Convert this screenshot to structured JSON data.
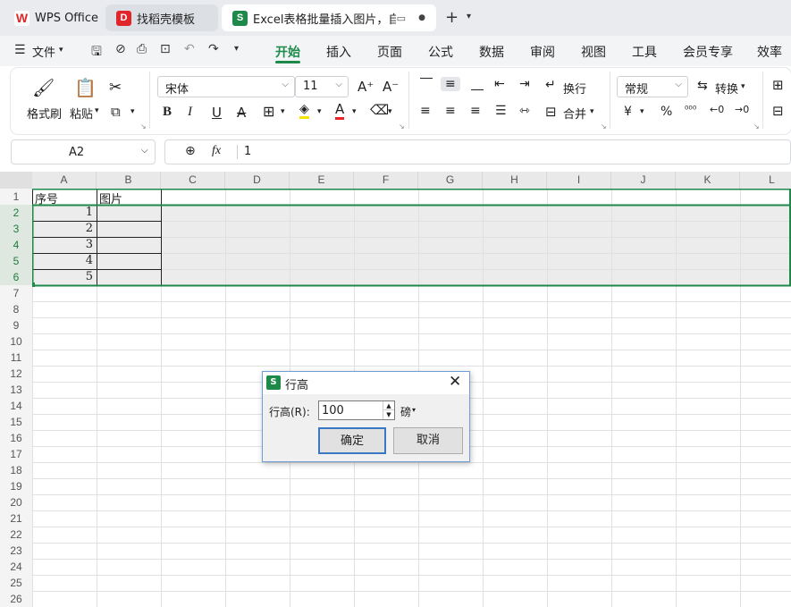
{
  "tabs": [
    {
      "label": "WPS Office",
      "icon": "wps-logo-icon"
    },
    {
      "label": "找稻壳模板",
      "icon": "docer-icon"
    },
    {
      "label": "Excel表格批量插入图片，自动",
      "icon": "spreadsheet-icon"
    }
  ],
  "menu": {
    "file_label": "文件",
    "items": [
      "开始",
      "插入",
      "页面",
      "公式",
      "数据",
      "审阅",
      "视图",
      "工具",
      "会员专享",
      "效率"
    ],
    "active": "开始"
  },
  "ribbon": {
    "format_painter": "格式刷",
    "paste": "粘贴",
    "font_name": "宋体",
    "font_size": "11",
    "wrap": "换行",
    "merge": "合并",
    "number_format": "常规",
    "convert": "转换",
    "currency_symbol": "¥",
    "percent_symbol": "%"
  },
  "formula_bar": {
    "name_box": "A2",
    "fx": "fx",
    "value": "1"
  },
  "grid": {
    "columns": [
      "A",
      "B",
      "C",
      "D",
      "E",
      "F",
      "G",
      "H",
      "I",
      "J",
      "K",
      "L"
    ],
    "rows": [
      "1",
      "2",
      "3",
      "4",
      "5",
      "6",
      "7",
      "8",
      "9",
      "10",
      "11",
      "12",
      "13",
      "14",
      "15",
      "16",
      "17",
      "18",
      "19",
      "20",
      "21",
      "22",
      "23",
      "24",
      "25",
      "26"
    ],
    "header_row": [
      "序号",
      "图片"
    ],
    "data": [
      "1",
      "2",
      "3",
      "4",
      "5"
    ],
    "selection_color": "#1e8a4a"
  },
  "dialog": {
    "title": "行高",
    "field_label": "行高(R):",
    "value": "100",
    "unit": "磅",
    "ok": "确定",
    "cancel": "取消"
  }
}
